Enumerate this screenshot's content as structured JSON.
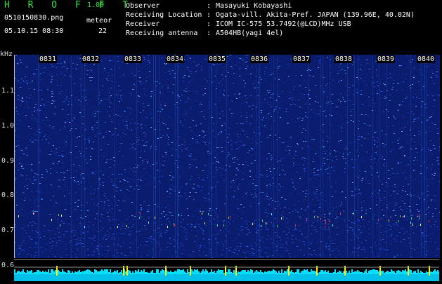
{
  "header": {
    "app_title": "H R O F F T",
    "app_version": "1.00",
    "filename": "0510150830.png",
    "meteor_label": "meteor",
    "datetime": "05.10.15 08:30",
    "meteor_count": "22"
  },
  "info": [
    {
      "key": "Observer",
      "sep": ":",
      "value": "Masayuki Kobayashi"
    },
    {
      "key": "Receiving Location",
      "sep": ":",
      "value": "Ogata-vill. Akita-Pref. JAPAN (139.96E, 40.02N)"
    },
    {
      "key": "Receiver",
      "sep": ":",
      "value": "ICOM IC-575 53.7492(@LCD)MHz USB"
    },
    {
      "key": "Receiving antenna",
      "sep": ":",
      "value": "A504HB(yagi 4el)"
    }
  ],
  "yaxis": {
    "unit": "kHz",
    "ticks": [
      "1.1",
      "1.0",
      "0.9",
      "0.8",
      "0.7",
      "0.6"
    ]
  },
  "xaxis": {
    "ticks": [
      "0831",
      "0832",
      "0833",
      "0834",
      "0835",
      "0836",
      "0837",
      "0838",
      "0839",
      "0840"
    ]
  },
  "colors": {
    "title_green": "#37e23c",
    "spectrogram_bg": "#0a1c6e",
    "signal_cyan": "#00e0ff",
    "meteor_yellow": "#ffff00"
  }
}
